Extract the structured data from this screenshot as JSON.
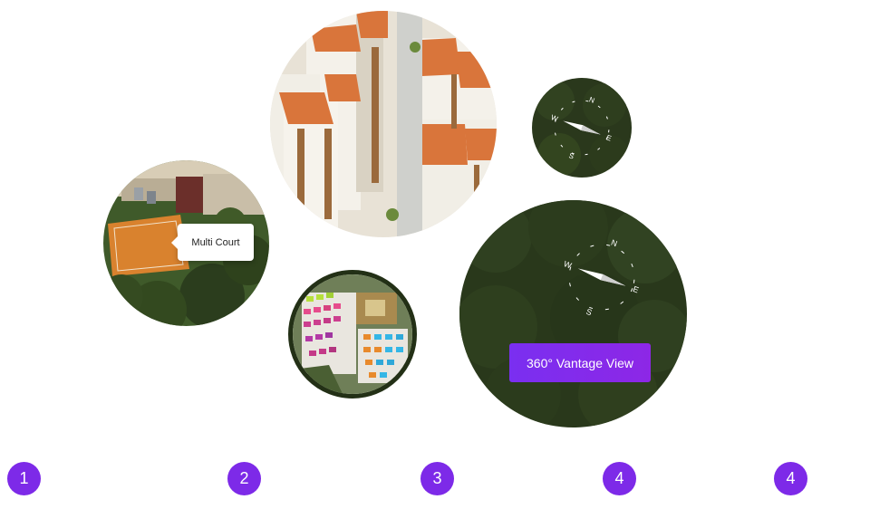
{
  "callout": {
    "label": "Multi Court"
  },
  "vantage": {
    "button_label": "360° Vantage View"
  },
  "compass": {
    "n": "N",
    "e": "E",
    "s": "S",
    "w": "W"
  },
  "steps": [
    "1",
    "2",
    "3",
    "4",
    "4"
  ],
  "colors": {
    "accent": "#7d2ae8",
    "button": "#8a2be2",
    "forest": "#2f3f1f",
    "roof": "#d9753b",
    "court": "#d9822e"
  },
  "icons": [
    "compass-icon",
    "compass-icon-large"
  ]
}
